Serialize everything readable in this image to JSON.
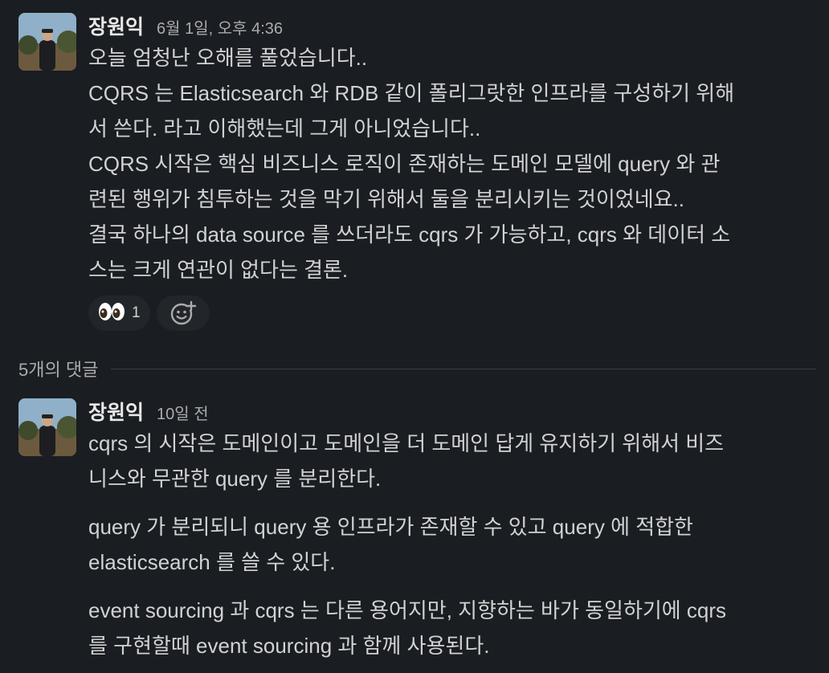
{
  "parent_message": {
    "author": "장원익",
    "timestamp": "6월 1일, 오후 4:36",
    "lines": [
      "오늘 엄청난 오해를 풀었습니다..",
      "CQRS 는 Elasticsearch 와 RDB 같이 폴리그랏한 인프라를 구성하기 위해",
      "서 쓴다. 라고 이해했는데 그게 아니었습니다..",
      "CQRS 시작은 핵심 비즈니스 로직이 존재하는 도메인 모델에 query 와 관",
      "련된 행위가 침투하는 것을 막기 위해서 둘을 분리시키는 것이었네요..",
      "결국 하나의 data source 를 쓰더라도 cqrs 가 가능하고, cqrs 와 데이터 소",
      "스는 크게 연관이 없다는 결론."
    ],
    "reactions": [
      {
        "emoji": "👀",
        "emoji_name": "eyes-icon",
        "count": "1"
      }
    ],
    "add_reaction_icon": "add-reaction-icon"
  },
  "replies_divider": {
    "label": "5개의 댓글"
  },
  "reply_message": {
    "author": "장원익",
    "timestamp": "10일 전",
    "paragraphs": [
      {
        "lines": [
          "cqrs 의 시작은 도메인이고 도메인을 더 도메인 답게 유지하기 위해서 비즈",
          "니스와 무관한 query 를 분리한다."
        ]
      },
      {
        "lines": [
          "query 가 분리되니 query 용 인프라가 존재할 수 있고 query 에 적합한",
          "elasticsearch 를 쓸 수 있다."
        ]
      },
      {
        "lines": [
          "event sourcing 과 cqrs 는 다른 용어지만, 지향하는 바가 동일하기에 cqrs",
          "를 구현할때 event sourcing 과 함께 사용된다."
        ]
      }
    ]
  },
  "colors": {
    "background": "#1a1d21",
    "text": "#d1d2d3",
    "muted": "#ababad",
    "reaction_bg": "#222529"
  }
}
